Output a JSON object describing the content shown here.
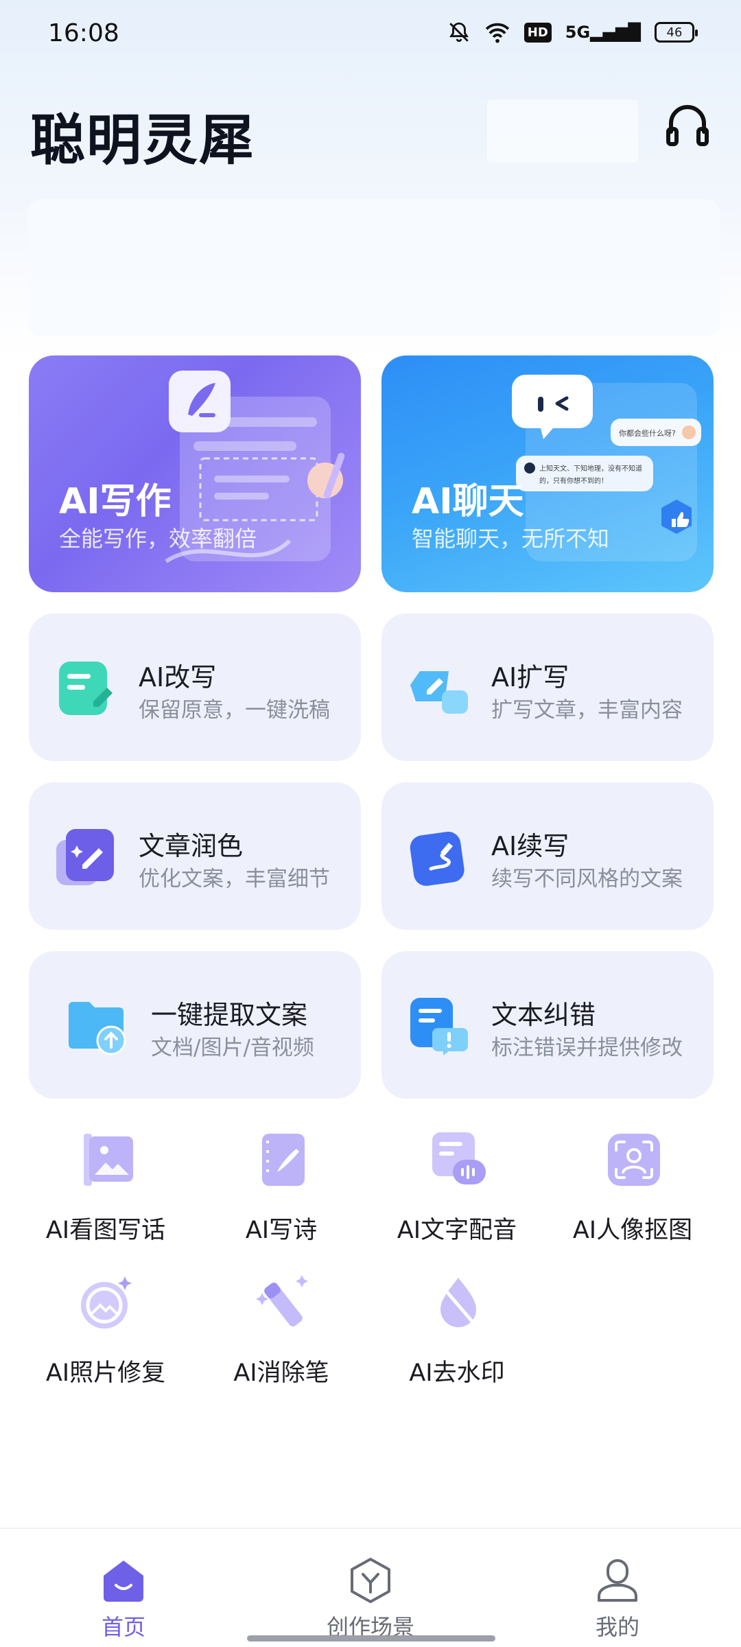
{
  "status_bar": {
    "time": "16:08",
    "battery": "46",
    "hd": "HD",
    "network": "5G"
  },
  "header": {
    "title": "聪明灵犀"
  },
  "hero_cards": [
    {
      "title": "AI写作",
      "subtitle": "全能写作，效率翻倍"
    },
    {
      "title": "AI聊天",
      "subtitle": "智能聊天，无所不知"
    }
  ],
  "chat_card_bubbles": {
    "question": "你都会些什么呀?",
    "answer_line1": "上知天文、下知地理，没有不知道",
    "answer_line2": "的，只有你想不到的！"
  },
  "features": [
    {
      "title": "AI改写",
      "subtitle": "保留原意，一键洗稿"
    },
    {
      "title": "AI扩写",
      "subtitle": "扩写文章，丰富内容"
    },
    {
      "title": "文章润色",
      "subtitle": "优化文案，丰富细节"
    },
    {
      "title": "AI续写",
      "subtitle": "续写不同风格的文案"
    },
    {
      "title": "一键提取文案",
      "subtitle": "文档/图片/音视频"
    },
    {
      "title": "文本纠错",
      "subtitle": "标注错误并提供修改"
    }
  ],
  "tools": [
    {
      "label": "AI看图写话"
    },
    {
      "label": "AI写诗"
    },
    {
      "label": "AI文字配音"
    },
    {
      "label": "AI人像抠图"
    },
    {
      "label": "AI照片修复"
    },
    {
      "label": "AI消除笔"
    },
    {
      "label": "AI去水印"
    }
  ],
  "bottom_nav": [
    {
      "label": "首页",
      "active": true
    },
    {
      "label": "创作场景",
      "active": false
    },
    {
      "label": "我的",
      "active": false
    }
  ],
  "colors": {
    "accent": "#6f60e8",
    "write_card": "#8a7cf5",
    "chat_card": "#3aa4f8",
    "feature_bg": "#eef1fc"
  }
}
